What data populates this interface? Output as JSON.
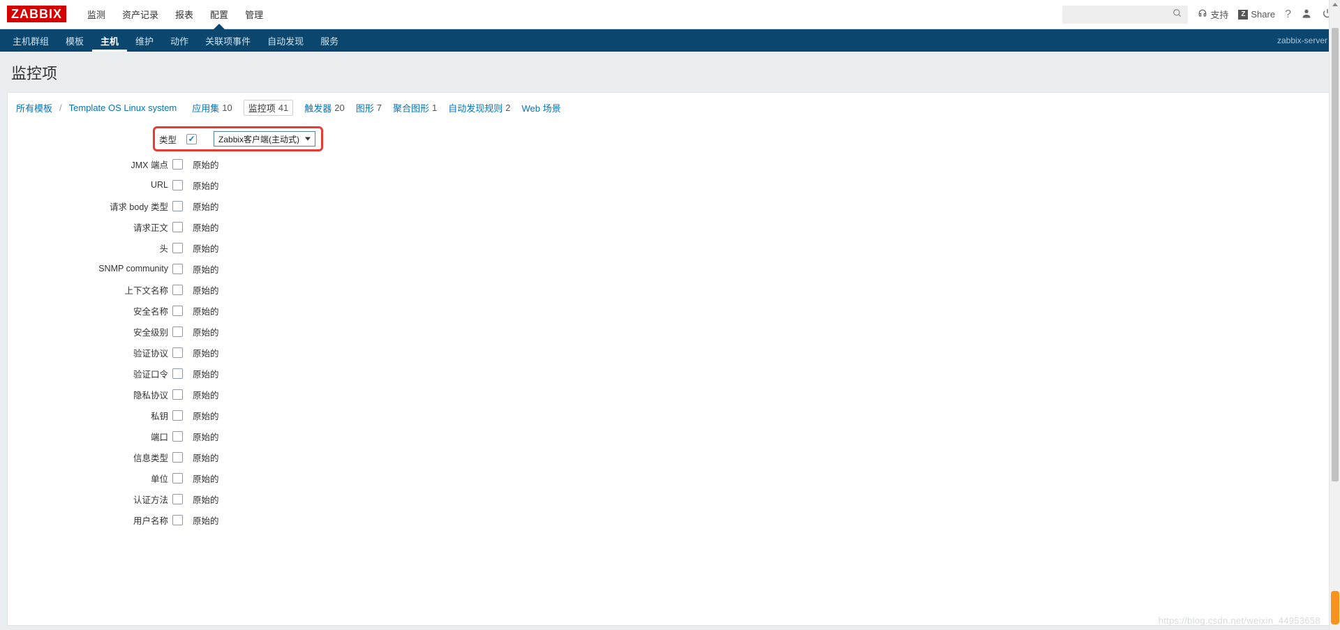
{
  "logo": "ZABBIX",
  "topnav": {
    "items": [
      "监测",
      "资产记录",
      "报表",
      "配置",
      "管理"
    ],
    "active_index": 3
  },
  "top_right": {
    "support": "支持",
    "share": "Share"
  },
  "subnav": {
    "items": [
      "主机群组",
      "模板",
      "主机",
      "维护",
      "动作",
      "关联项事件",
      "自动发现",
      "服务"
    ],
    "active_index": 2,
    "server": "zabbix-server"
  },
  "page_title": "监控项",
  "breadcrumbs": {
    "all_templates": "所有模板",
    "template": "Template OS Linux system",
    "tabs": [
      {
        "label": "应用集",
        "count": "10"
      },
      {
        "label": "监控项",
        "count": "41",
        "active": true
      },
      {
        "label": "触发器",
        "count": "20"
      },
      {
        "label": "图形",
        "count": "7"
      },
      {
        "label": "聚合图形",
        "count": "1"
      },
      {
        "label": "自动发现规则",
        "count": "2"
      },
      {
        "label": "Web 场景",
        "count": ""
      }
    ]
  },
  "form": {
    "type_label": "类型",
    "type_value": "Zabbix客户端(主动式)",
    "original": "原始的",
    "rows": [
      "JMX 端点",
      "URL",
      "请求 body 类型",
      "请求正文",
      "头",
      "SNMP community",
      "上下文名称",
      "安全名称",
      "安全级别",
      "验证协议",
      "验证口令",
      "隐私协议",
      "私钥",
      "端口",
      "信息类型",
      "单位",
      "认证方法",
      "用户名称"
    ]
  },
  "watermark": "https://blog.csdn.net/weixin_44953658"
}
